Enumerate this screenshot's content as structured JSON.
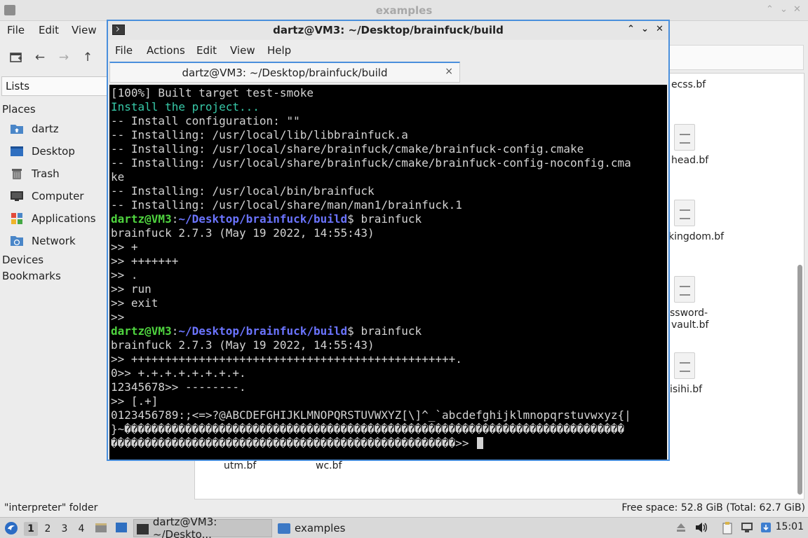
{
  "file_manager": {
    "title": "examples",
    "menu": [
      "File",
      "Edit",
      "View"
    ],
    "lists_label": "Lists",
    "sidebar": {
      "places_header": "Places",
      "items": [
        {
          "label": "dartz",
          "icon": "home-folder-icon"
        },
        {
          "label": "Desktop",
          "icon": "desktop-icon"
        },
        {
          "label": "Trash",
          "icon": "trash-icon"
        },
        {
          "label": "Computer",
          "icon": "computer-icon"
        },
        {
          "label": "Applications",
          "icon": "applications-icon"
        },
        {
          "label": "Network",
          "icon": "network-icon"
        }
      ],
      "devices_header": "Devices",
      "bookmarks_header": "Bookmarks"
    },
    "files": [
      "ecss.bf",
      "head.bf",
      "kingdom.bf",
      "ssword-",
      "vault.bf",
      "isihi.bf",
      "utm.bf",
      "wc.bf"
    ],
    "status_left": "\"interpreter\" folder",
    "status_right": "Free space: 52.8 GiB (Total: 62.7 GiB)"
  },
  "terminal": {
    "title": "dartz@VM3: ~/Desktop/brainfuck/build",
    "menu": [
      "File",
      "Actions",
      "Edit",
      "View",
      "Help"
    ],
    "tab_label": "dartz@VM3: ~/Desktop/brainfuck/build",
    "tab_close": "×",
    "controls": {
      "shade": "⌃",
      "minimize": "⌄",
      "maximize": "⤢",
      "close": "✕"
    },
    "prompt_user": "dartz@VM3",
    "prompt_path": "~/Desktop/brainfuck/build",
    "lines": [
      {
        "t": "[100%] Built target test-smoke"
      },
      {
        "t": "Install the project...",
        "teal": true
      },
      {
        "t": "-- Install configuration: \"\""
      },
      {
        "t": "-- Installing: /usr/local/lib/libbrainfuck.a"
      },
      {
        "t": "-- Installing: /usr/local/share/brainfuck/cmake/brainfuck-config.cmake"
      },
      {
        "t": "-- Installing: /usr/local/share/brainfuck/cmake/brainfuck-config-noconfig.cma"
      },
      {
        "t": "ke"
      },
      {
        "t": "-- Installing: /usr/local/bin/brainfuck"
      },
      {
        "t": "-- Installing: /usr/local/share/man/man1/brainfuck.1"
      },
      {
        "prompt": true,
        "t": "$ brainfuck"
      },
      {
        "t": "brainfuck 2.7.3 (May 19 2022, 14:55:43)"
      },
      {
        "t": ">> +"
      },
      {
        "t": ">> +++++++"
      },
      {
        "t": ">> ."
      },
      {
        "t": ">> run"
      },
      {
        "t": ">> exit"
      },
      {
        "t": ">>"
      },
      {
        "prompt": true,
        "t": "$ brainfuck"
      },
      {
        "t": "brainfuck 2.7.3 (May 19 2022, 14:55:43)"
      },
      {
        "t": ">> ++++++++++++++++++++++++++++++++++++++++++++++++."
      },
      {
        "t": "0>> +.+.+.+.+.+.+.+."
      },
      {
        "t": "12345678>> --------."
      },
      {
        "t": ">> [.+]"
      },
      {
        "t": "0123456789:;<=>?@ABCDEFGHIJKLMNOPQRSTUVWXYZ[\\]^_`abcdefghijklmnopqrstuvwxyz{|"
      },
      {
        "t": "}~��������������������������������������������������������������������������"
      },
      {
        "t": "���������������������������������������������������>> ",
        "cursor": true
      }
    ]
  },
  "taskbar": {
    "workspaces": [
      "1",
      "2",
      "3",
      "4"
    ],
    "tasks": [
      {
        "label": "dartz@VM3: ~/Deskto...",
        "icon": "terminal-icon",
        "active": true
      },
      {
        "label": "examples",
        "icon": "folder-icon",
        "active": false
      }
    ],
    "clock": "15:01"
  }
}
